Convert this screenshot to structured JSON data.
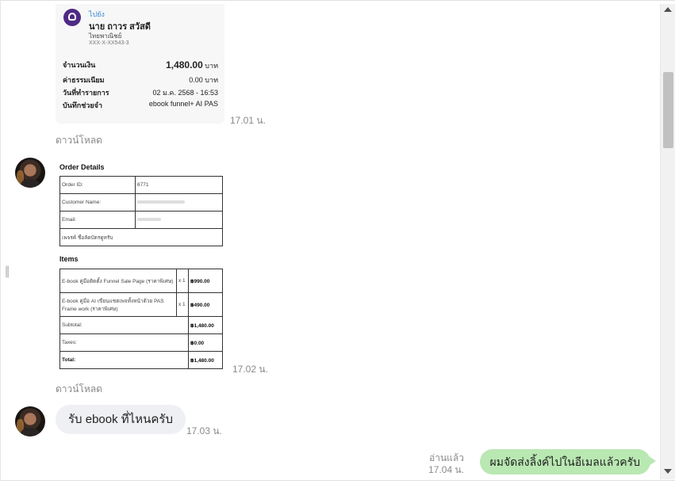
{
  "messages": {
    "slip": {
      "to_label": "ไปยัง",
      "recipient": "นาย ถาวร สวัสดี",
      "bank": "ไทยพาณิชย์",
      "account": "XXX-X-XX543-3",
      "rows": [
        {
          "label": "จำนวนเงิน",
          "value": "1,480.00",
          "unit": "บาท"
        },
        {
          "label": "ค่าธรรมเนียม",
          "value": "0.00",
          "unit": "บาท"
        },
        {
          "label": "วันที่ทำรายการ",
          "value": "02 ม.ค. 2568 - 16:53",
          "unit": ""
        },
        {
          "label": "บันทึกช่วยจำ",
          "value": "ebook funnel+ AI PAS",
          "unit": ""
        }
      ],
      "time": "17.01 น.",
      "download": "ดาวน์โหลด"
    },
    "order": {
      "title": "Order Details",
      "fields": [
        {
          "label": "Order ID:",
          "value": "6771"
        },
        {
          "label": "Customer Name:",
          "value": ""
        },
        {
          "label": "Email:",
          "value": ""
        }
      ],
      "note": "เพจรค์ ชื่อลัดบัตรดูหรับ",
      "items_title": "Items",
      "items": [
        {
          "name": "E-book คู่มือติดตั้ง Funnel Sale Page (ราคาพิเศษ)",
          "qty": "x 1",
          "price": "฿990.00"
        },
        {
          "name": "E-book คู่มือ AI เขียนแชตเพจทั้งหน้าด้วย PAS Frame work (ราคาพิเศษ)",
          "qty": "x 1",
          "price": "฿490.00"
        }
      ],
      "totals": [
        {
          "label": "Subtotal:",
          "value": "฿1,480.00"
        },
        {
          "label": "Taxes:",
          "value": "฿0.00"
        },
        {
          "label": "Total:",
          "value": "฿1,480.00"
        }
      ],
      "time": "17.02 น.",
      "download": "ดาวน์โหลด"
    },
    "incoming": {
      "text": "รับ ebook ที่ไหนครับ",
      "time": "17.03 น."
    },
    "outgoing": {
      "text": "ผมจัดส่งลิ้งค์ไปในอีเมลแล้วครับ",
      "read": "อ่านแล้ว",
      "time": "17.04 น."
    }
  },
  "colors": {
    "outgoing_bubble": "#b9e8b2",
    "incoming_bubble": "#eef0f3",
    "bank_brand": "#4e2a84"
  }
}
